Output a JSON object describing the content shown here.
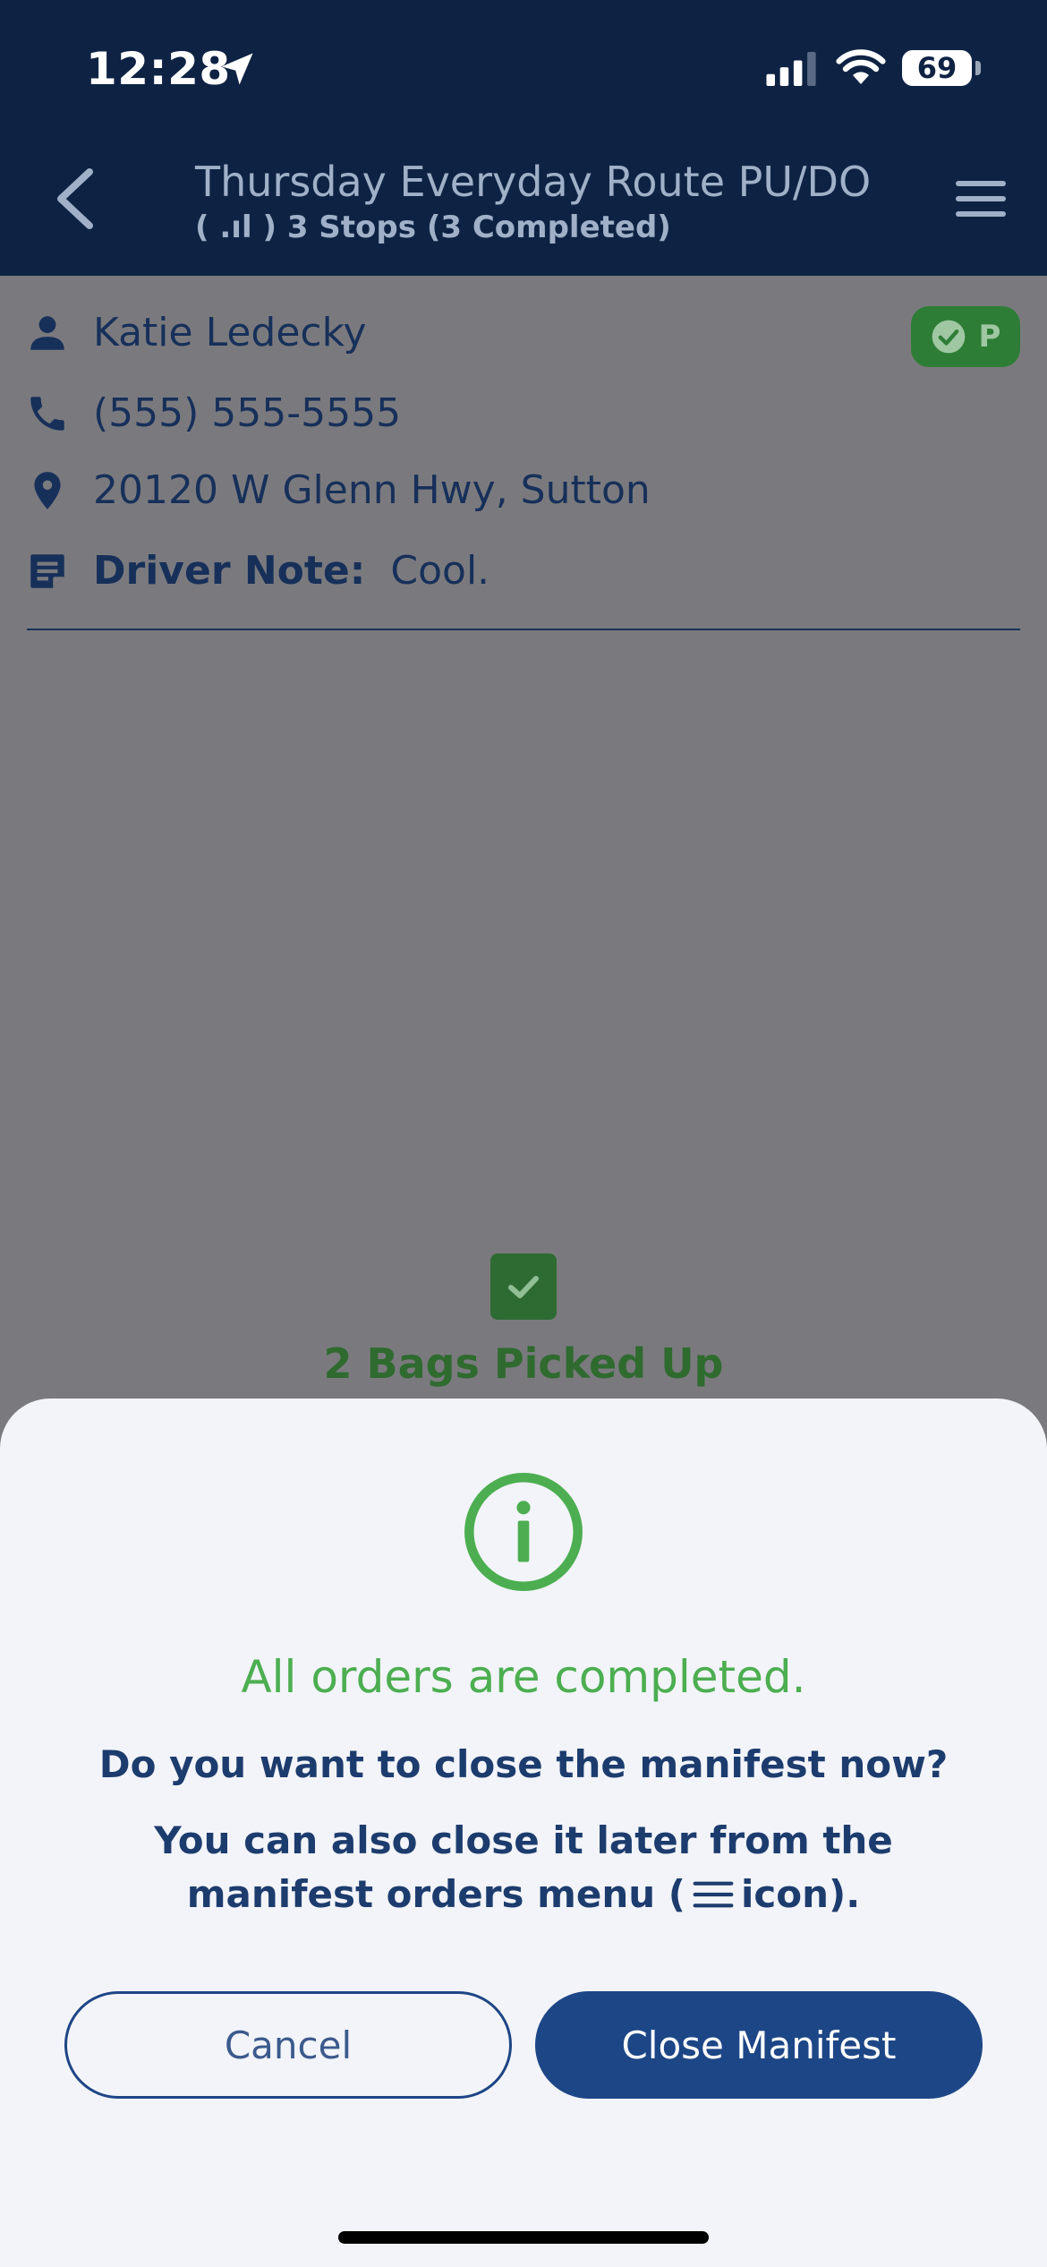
{
  "status_bar": {
    "time": "12:28",
    "battery": "69"
  },
  "header": {
    "title": "Thursday Everyday Route PU/DO",
    "subtitle": "( .ıl ) 3 Stops (3 Completed)"
  },
  "stop": {
    "name": "Katie Ledecky",
    "phone": "(555) 555-5555",
    "address": "20120 W Glenn Hwy, Sutton",
    "note_label": "Driver Note:",
    "note_value": "Cool.",
    "badge_letter": "P",
    "bags_status": "2 Bags Picked Up"
  },
  "dialog": {
    "title": "All orders are completed.",
    "question": "Do you want to close the manifest now?",
    "hint_before": "You can also close it later from the manifest orders menu (",
    "hint_after": "icon).",
    "cancel_label": "Cancel",
    "confirm_label": "Close Manifest"
  },
  "colors": {
    "header_bg": "#0e2344",
    "primary": "#1d4686",
    "success": "#4cae50",
    "overlay": "#7a7a7e",
    "sheet_bg": "#f2f4f9"
  },
  "icons": {
    "location_arrow": "location-arrow-icon",
    "signal": "cellular-signal-icon",
    "wifi": "wifi-icon",
    "back": "chevron-left-icon",
    "menu": "hamburger-menu-icon",
    "person": "person-icon",
    "phone": "phone-icon",
    "pin": "map-pin-icon",
    "note": "note-icon",
    "check_circle": "check-circle-icon",
    "checkbox": "checkbox-checked-icon",
    "info": "info-circle-icon"
  }
}
